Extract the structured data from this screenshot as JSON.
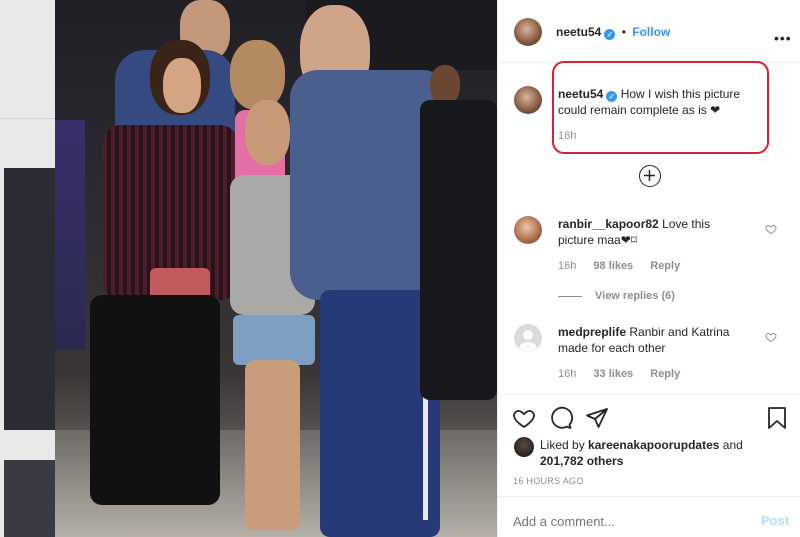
{
  "header": {
    "username": "neetu54",
    "separator": "•",
    "follow_label": "Follow"
  },
  "caption": {
    "username": "neetu54",
    "text": "How I wish this picture could remain complete as is ❤",
    "time": "16h"
  },
  "comments": [
    {
      "username": "ranbir__kapoor82",
      "text": "Love this picture maa❤⌑",
      "time": "16h",
      "likes": "98 likes",
      "reply_label": "Reply",
      "view_replies": "View replies (6)"
    },
    {
      "username": "medpreplife",
      "text": "Ranbir and Katrina made for each other",
      "time": "16h",
      "likes": "33 likes",
      "reply_label": "Reply"
    }
  ],
  "likes": {
    "prefix": "Liked by",
    "user": "kareenakapoorupdates",
    "and": "and",
    "others": "201,782 others"
  },
  "post_time": "16 HOURS AGO",
  "add_comment": {
    "placeholder": "Add a comment...",
    "post_label": "Post"
  },
  "colors": {
    "accent": "#3897f0",
    "highlight": "#d92030",
    "post_disabled": "#b2dffc"
  }
}
